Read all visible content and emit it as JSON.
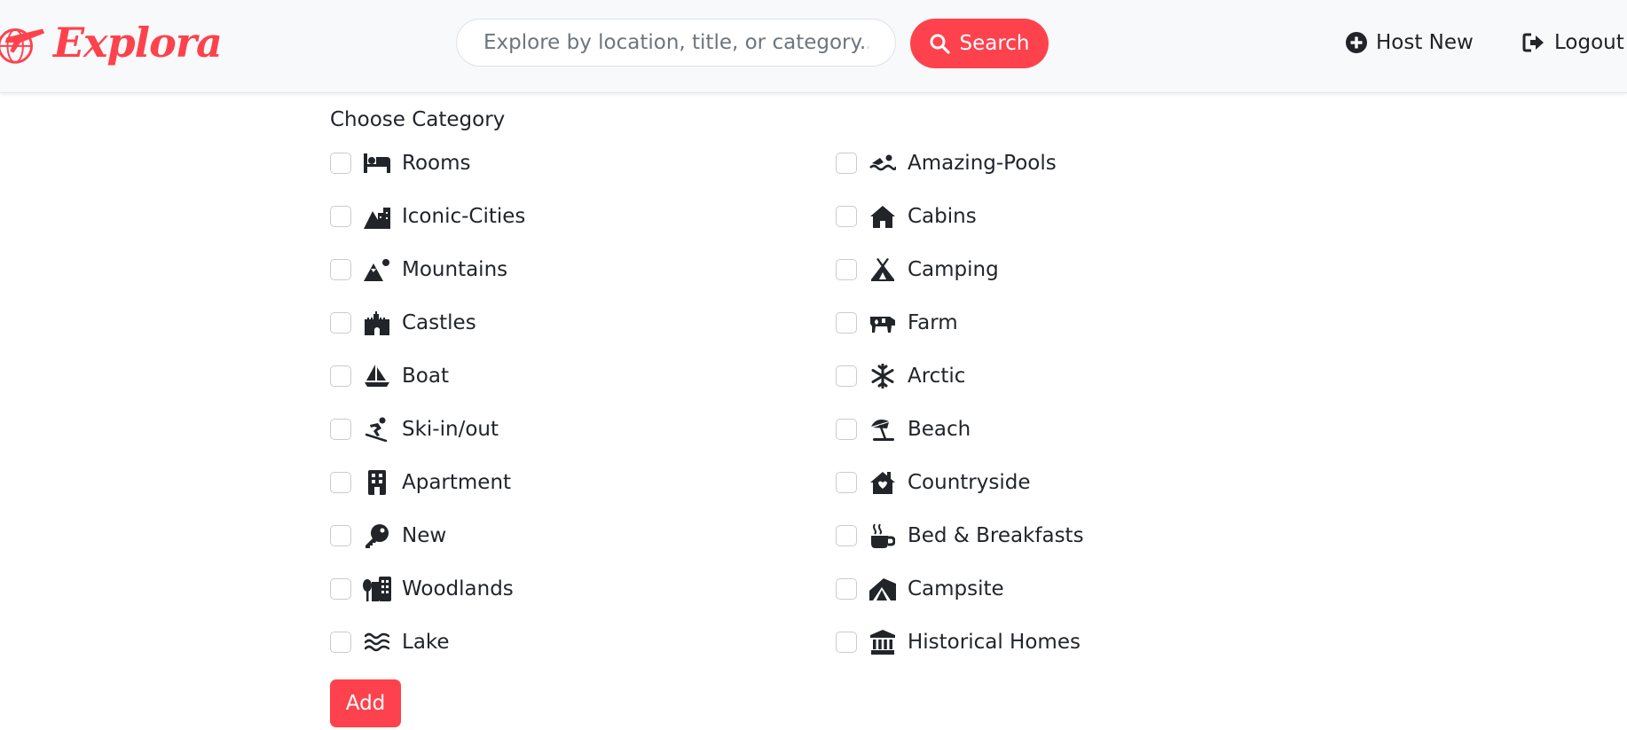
{
  "brand": {
    "name": "Explora",
    "icon": "airplane-globe-logo",
    "color": "#fe424d"
  },
  "search": {
    "placeholder": "Explore by location, title, or category...",
    "value": "",
    "button_label": "Search",
    "icon": "search-icon"
  },
  "nav": {
    "host_label": "Host New",
    "host_icon": "plus-circle-icon",
    "logout_label": "Logout",
    "logout_icon": "logout-icon"
  },
  "form": {
    "label": "Choose Category",
    "categories": [
      {
        "label": "Rooms",
        "icon": "bed-icon",
        "checked": false
      },
      {
        "label": "Amazing-Pools",
        "icon": "swimmer-icon",
        "checked": false
      },
      {
        "label": "Iconic-Cities",
        "icon": "mountain-city-icon",
        "checked": false
      },
      {
        "label": "Cabins",
        "icon": "house-icon",
        "checked": false
      },
      {
        "label": "Mountains",
        "icon": "mountain-sun-icon",
        "checked": false
      },
      {
        "label": "Camping",
        "icon": "tent-icon",
        "checked": false
      },
      {
        "label": "Castles",
        "icon": "castle-icon",
        "checked": false
      },
      {
        "label": "Farm",
        "icon": "cow-icon",
        "checked": false
      },
      {
        "label": "Boat",
        "icon": "sailboat-icon",
        "checked": false
      },
      {
        "label": "Arctic",
        "icon": "snowflake-icon",
        "checked": false
      },
      {
        "label": "Ski-in/out",
        "icon": "snowboarding-icon",
        "checked": false
      },
      {
        "label": "Beach",
        "icon": "umbrella-beach-icon",
        "checked": false
      },
      {
        "label": "Apartment",
        "icon": "building-icon",
        "checked": false
      },
      {
        "label": "Countryside",
        "icon": "house-chimney-icon",
        "checked": false
      },
      {
        "label": "New",
        "icon": "key-icon",
        "checked": false
      },
      {
        "label": "Bed & Breakfasts",
        "icon": "mug-hot-icon",
        "checked": false
      },
      {
        "label": "Woodlands",
        "icon": "tree-city-icon",
        "checked": false
      },
      {
        "label": "Campsite",
        "icon": "campground-icon",
        "checked": false
      },
      {
        "label": "Lake",
        "icon": "water-icon",
        "checked": false
      },
      {
        "label": "Historical Homes",
        "icon": "landmark-icon",
        "checked": false
      }
    ],
    "submit_label": "Add"
  },
  "colors": {
    "accent": "#fe424d",
    "navbar_bg": "#f8f9fa",
    "text": "#212529"
  }
}
